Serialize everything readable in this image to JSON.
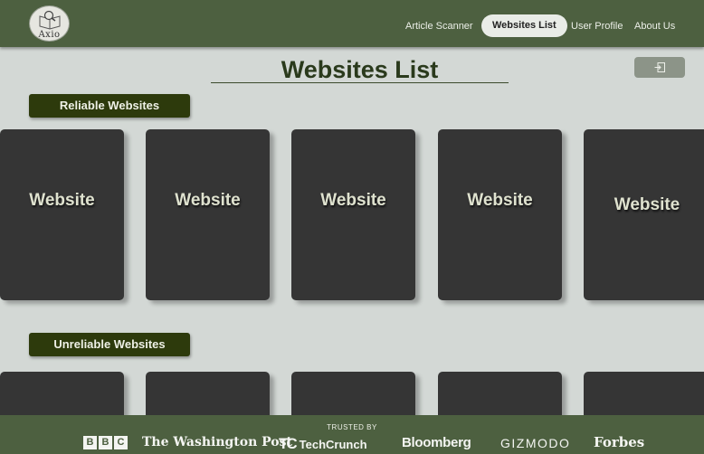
{
  "app": {
    "logo_text": "Axio"
  },
  "nav": {
    "items": [
      {
        "label": "Article Scanner"
      },
      {
        "label": "Websites List"
      },
      {
        "label": "User Profile"
      },
      {
        "label": "About Us"
      }
    ],
    "active": "Websites List"
  },
  "page": {
    "title": "Websites List"
  },
  "sections": {
    "reliable": {
      "label": "Reliable Websites",
      "cards": [
        "Website",
        "Website",
        "Website",
        "Website",
        "Website"
      ]
    },
    "unreliable": {
      "label": "Unreliable Websites",
      "cards": [
        "",
        "",
        "",
        "",
        ""
      ]
    }
  },
  "footer": {
    "trusted_label": "TRUSTED BY",
    "brands": {
      "bbc": [
        "B",
        "B",
        "C"
      ],
      "washington_post": "The Washington Post",
      "techcrunch": "TechCrunch",
      "techcrunch_mark": "TC",
      "bloomberg": "Bloomberg",
      "gizmodo": "GIZMODO",
      "forbes": "Forbes"
    }
  },
  "colors": {
    "header_bg": "#4d6040",
    "page_bg": "#d3d8d5",
    "card_bg": "#353535",
    "pill_bg": "#2d3a0c",
    "title_color": "#2a3a1c"
  },
  "icons": {
    "logo": "book-magnifier-icon",
    "exit": "exit-icon"
  }
}
